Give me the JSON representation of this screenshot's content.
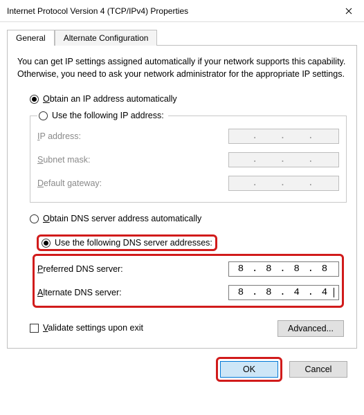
{
  "window": {
    "title": "Internet Protocol Version 4 (TCP/IPv4) Properties"
  },
  "tabs": {
    "general": "General",
    "alternate": "Alternate Configuration"
  },
  "intro": "You can get IP settings assigned automatically if your network supports this capability. Otherwise, you need to ask your network administrator for the appropriate IP settings.",
  "ip": {
    "auto_prefix": "O",
    "auto_rest": "btain an IP address automatically",
    "manual_prefix": "Use the following IP address:",
    "label_ip_pre": "I",
    "label_ip_rest": "P address:",
    "label_mask_pre": "S",
    "label_mask_rest": "ubnet mask:",
    "label_gw_pre": "D",
    "label_gw_rest": "efault gateway:"
  },
  "dns": {
    "auto_pre": "O",
    "auto_rest": "btain DNS server address automatically",
    "manual_pre": "Use the following DNS server addresses:",
    "label_pref_pre": "P",
    "label_pref_rest": "referred DNS server:",
    "label_alt_pre": "A",
    "label_alt_rest": "lternate DNS server:",
    "preferred": {
      "o1": "8",
      "o2": "8",
      "o3": "8",
      "o4": "8"
    },
    "alternate": {
      "o1": "8",
      "o2": "8",
      "o3": "4",
      "o4": "4"
    }
  },
  "validate_pre": "V",
  "validate_rest": "alidate settings upon exit",
  "buttons": {
    "advanced": "Advanced...",
    "ok": "OK",
    "cancel": "Cancel"
  },
  "dot": "."
}
